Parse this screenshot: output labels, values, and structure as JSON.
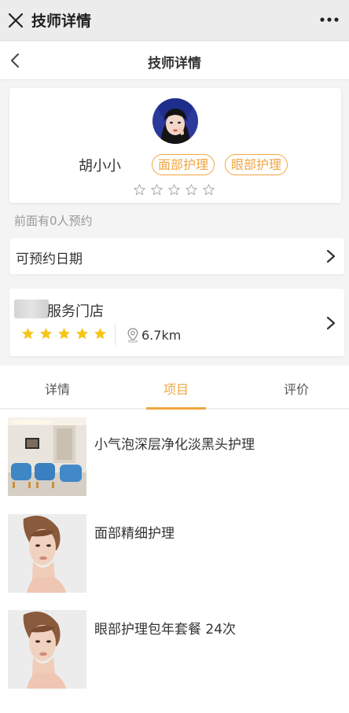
{
  "window": {
    "title": "技师详情",
    "close_icon": "close-icon",
    "more_icon": "more-dots-icon"
  },
  "navbar": {
    "title": "技师详情",
    "back_icon": "back-chevron-icon"
  },
  "profile": {
    "name": "胡小小",
    "tags": [
      "面部护理",
      "眼部护理"
    ],
    "rating": 0,
    "rating_max": 5
  },
  "queue_text": "前面有0人预约",
  "booking": {
    "label": "可预约日期"
  },
  "store": {
    "name": "服务门店",
    "rating": 5,
    "distance": "6.7km"
  },
  "tabs": [
    "详情",
    "项目",
    "评价"
  ],
  "active_tab": 1,
  "items": [
    {
      "title": "小气泡深层净化淡黑头护理",
      "image": "salon-room"
    },
    {
      "title": "面部精细护理",
      "image": "woman-face"
    },
    {
      "title": "眼部护理包年套餐 24次",
      "image": "woman-face"
    }
  ],
  "colors": {
    "accent": "#f0a641",
    "star": "#f5c518",
    "topbar_bg": "#ececec"
  }
}
